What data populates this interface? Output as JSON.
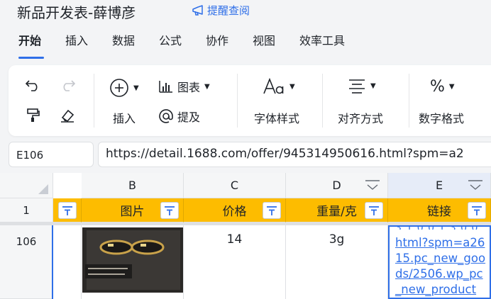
{
  "header": {
    "doc_title": "新品开发表-薛博彦",
    "reminder_label": "提醒查阅"
  },
  "tabs": [
    {
      "label": "开始",
      "active": true
    },
    {
      "label": "插入",
      "active": false
    },
    {
      "label": "数据",
      "active": false
    },
    {
      "label": "公式",
      "active": false
    },
    {
      "label": "协作",
      "active": false
    },
    {
      "label": "视图",
      "active": false
    },
    {
      "label": "效率工具",
      "active": false
    }
  ],
  "toolbar": {
    "insert_label": "插入",
    "chart_label": "图表",
    "mention_label": "提及",
    "font_style_label": "字体样式",
    "align_label": "对齐方式",
    "number_format_label": "数字格式"
  },
  "formula_bar": {
    "cell_ref": "E106",
    "value": "https://detail.1688.com/offer/945314950616.html?spm=a2"
  },
  "grid": {
    "columns": [
      "B",
      "C",
      "D",
      "E"
    ],
    "active_column": "E",
    "rows": [
      "1",
      "106"
    ],
    "header_row": [
      "图片",
      "价格",
      "重量/克",
      "链接"
    ],
    "data_row": {
      "price": "14",
      "weight": "3g",
      "link_text": "html?spm=a2615.pc_new_goods/2506.wp_pc_new_product"
    }
  },
  "colors": {
    "accent": "#2f6fe8",
    "header_fill": "#fdbc00",
    "link": "#2f6fe8"
  }
}
